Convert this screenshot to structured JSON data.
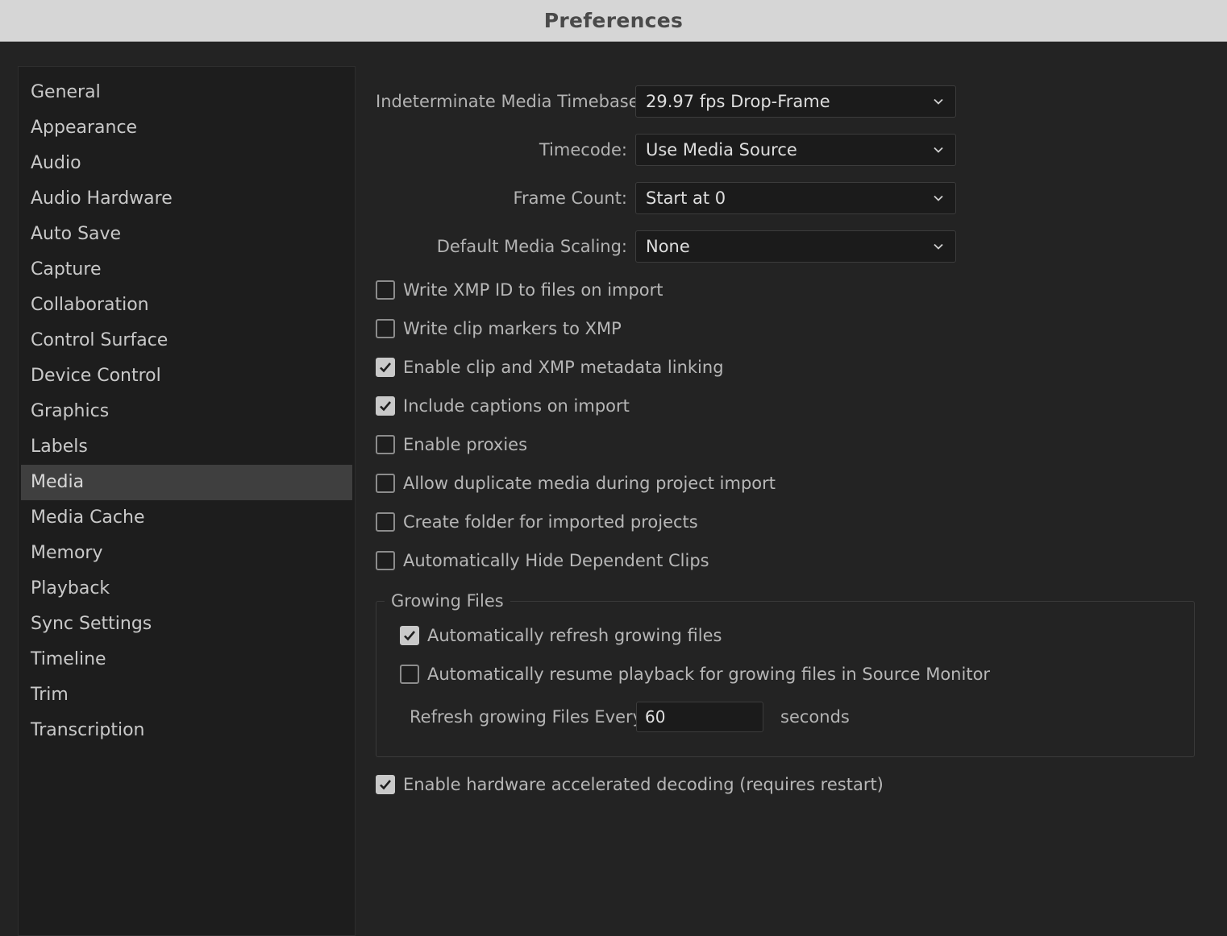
{
  "window": {
    "title": "Preferences"
  },
  "sidebar": {
    "items": [
      {
        "label": "General",
        "selected": false
      },
      {
        "label": "Appearance",
        "selected": false
      },
      {
        "label": "Audio",
        "selected": false
      },
      {
        "label": "Audio Hardware",
        "selected": false
      },
      {
        "label": "Auto Save",
        "selected": false
      },
      {
        "label": "Capture",
        "selected": false
      },
      {
        "label": "Collaboration",
        "selected": false
      },
      {
        "label": "Control Surface",
        "selected": false
      },
      {
        "label": "Device Control",
        "selected": false
      },
      {
        "label": "Graphics",
        "selected": false
      },
      {
        "label": "Labels",
        "selected": false
      },
      {
        "label": "Media",
        "selected": true
      },
      {
        "label": "Media Cache",
        "selected": false
      },
      {
        "label": "Memory",
        "selected": false
      },
      {
        "label": "Playback",
        "selected": false
      },
      {
        "label": "Sync Settings",
        "selected": false
      },
      {
        "label": "Timeline",
        "selected": false
      },
      {
        "label": "Trim",
        "selected": false
      },
      {
        "label": "Transcription",
        "selected": false
      }
    ]
  },
  "media": {
    "selects": [
      {
        "label": "Indeterminate Media Timebase:",
        "value": "29.97 fps Drop-Frame"
      },
      {
        "label": "Timecode:",
        "value": "Use Media Source"
      },
      {
        "label": "Frame Count:",
        "value": "Start at 0"
      },
      {
        "label": "Default Media Scaling:",
        "value": "None"
      }
    ],
    "checkboxes": [
      {
        "label": "Write XMP ID to files on import",
        "checked": false
      },
      {
        "label": "Write clip markers to XMP",
        "checked": false
      },
      {
        "label": "Enable clip and XMP metadata linking",
        "checked": true
      },
      {
        "label": "Include captions on import",
        "checked": true
      },
      {
        "label": "Enable proxies",
        "checked": false
      },
      {
        "label": "Allow duplicate media during project import",
        "checked": false
      },
      {
        "label": "Create folder for imported projects",
        "checked": false
      },
      {
        "label": "Automatically Hide Dependent Clips",
        "checked": false
      }
    ],
    "growing_files": {
      "legend": "Growing Files",
      "checkboxes": [
        {
          "label": "Automatically refresh growing files",
          "checked": true
        },
        {
          "label": "Automatically resume playback for growing files in Source Monitor",
          "checked": false
        }
      ],
      "refresh_label": "Refresh growing Files Every",
      "refresh_value": "60",
      "refresh_unit": "seconds"
    },
    "hardware_decoding": {
      "label": "Enable hardware accelerated decoding (requires restart)",
      "checked": true
    }
  },
  "icons": {
    "dropdown": "chevron-down-icon",
    "check": "checkmark-icon"
  }
}
